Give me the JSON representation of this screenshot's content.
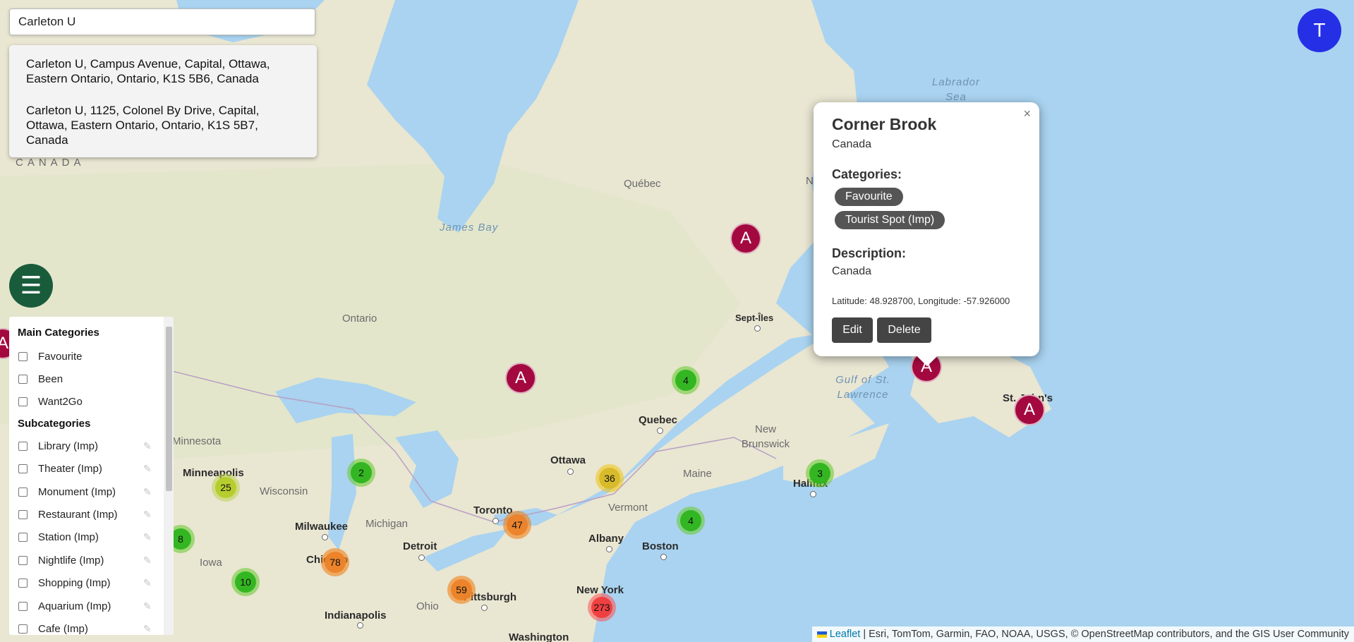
{
  "search": {
    "value": "Carleton U"
  },
  "suggestions": [
    "Carleton U, Campus Avenue, Capital, Ottawa, Eastern Ontario, Ontario, K1S 5B6, Canada",
    "Carleton U, 1125, Colonel By Drive, Capital, Ottawa, Eastern Ontario, Ontario, K1S 5B7, Canada"
  ],
  "user": {
    "initial": "T",
    "color": "#2530e6"
  },
  "menu": {
    "icon": "hamburger-icon",
    "glyph": "☰"
  },
  "panel": {
    "main_title": "Main Categories",
    "main_items": [
      "Favourite",
      "Been",
      "Want2Go"
    ],
    "sub_title": "Subcategories",
    "sub_items": [
      "Library (Imp)",
      "Theater (Imp)",
      "Monument (Imp)",
      "Restaurant (Imp)",
      "Station (Imp)",
      "Nightlife (Imp)",
      "Shopping (Imp)",
      "Aquarium (Imp)",
      "Cafe (Imp)"
    ],
    "edit_icon": "pencil-icon"
  },
  "popup": {
    "title": "Corner Brook",
    "subtitle": "Canada",
    "categories_label": "Categories:",
    "categories": [
      "Favourite",
      "Tourist Spot (Imp)"
    ],
    "description_label": "Description:",
    "description": "Canada",
    "coords": "Latitude: 48.928700, Longitude: -57.926000",
    "edit_label": "Edit",
    "delete_label": "Delete",
    "close_glyph": "×"
  },
  "clusters": [
    {
      "count": "4",
      "level": "green"
    },
    {
      "count": "2",
      "level": "green"
    },
    {
      "count": "25",
      "level": "lime"
    },
    {
      "count": "8",
      "level": "green"
    },
    {
      "count": "10",
      "level": "green"
    },
    {
      "count": "78",
      "level": "orange"
    },
    {
      "count": "36",
      "level": "yellow"
    },
    {
      "count": "47",
      "level": "orange"
    },
    {
      "count": "59",
      "level": "orange"
    },
    {
      "count": "4",
      "level": "green"
    },
    {
      "count": "273",
      "level": "red"
    },
    {
      "count": "3",
      "level": "green"
    }
  ],
  "pin_label": "A",
  "map_labels": {
    "canada": "CANADA",
    "labrador_sea": "Labrador Sea",
    "quebec_region": "Québec",
    "james_bay": "James Bay",
    "ontario": "Ontario",
    "gulf": "Gulf of St. Lawrence",
    "new_brunswick": "New Brunswick",
    "maine": "Maine",
    "vermont": "Vermont",
    "minnesota": "Minnesota",
    "wisconsin": "Wisconsin",
    "michigan": "Michigan",
    "iowa": "Iowa",
    "ohio": "Ohio",
    "sept_iles": "Sept-Îles",
    "quebec_city": "Quebec",
    "ottawa": "Ottawa",
    "minneapolis": "Minneapolis",
    "milwaukee": "Milwaukee",
    "chicago": "Chicago",
    "detroit": "Detroit",
    "toronto": "Toronto",
    "albany": "Albany",
    "boston": "Boston",
    "new_york": "New York",
    "pittsburgh": "Pittsburgh",
    "indianapolis": "Indianapolis",
    "washington": "Washington",
    "halifax": "Halifax",
    "st_johns": "St. John's",
    "nova": "N"
  },
  "attribution": {
    "link": "Leaflet",
    "text": "| Esri, TomTom, Garmin, FAO, NOAA, USGS, © OpenStreetMap contributors, and the GIS User Community"
  }
}
